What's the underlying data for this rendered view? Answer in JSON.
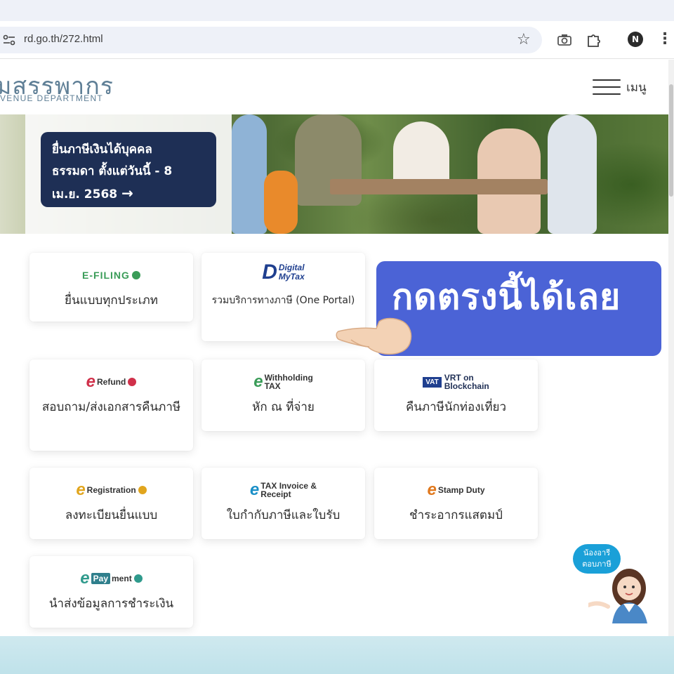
{
  "browser": {
    "url": "rd.go.th/272.html",
    "profile_initial": "N",
    "icons": [
      "site-info-icon",
      "star-icon",
      "camera-icon",
      "extensions-icon",
      "kebab-menu-icon"
    ]
  },
  "header": {
    "logo_main": "มสรรพากร",
    "logo_sub": "VENUE DEPARTMENT",
    "menu_label": "เมนู"
  },
  "hero": {
    "cta_line1": "ยื่นภาษีเงินได้บุคคล",
    "cta_line2": "ธรรมดา ตั้งแต่วันนี้ - 8",
    "cta_line3": "เม.ย. 2568",
    "cta_arrow": "→"
  },
  "services": [
    {
      "logo": "E-FILING",
      "label": "ยื่นแบบทุกประเภท",
      "color": "#3a9c58"
    },
    {
      "logo_line1": "Digital",
      "logo_line2": "MyTax",
      "label": "รวมบริการทางภาษี (One Portal)",
      "color": "#1f3f8f"
    },
    {
      "logo": "Refund",
      "label": "สอบถาม/ส่งเอกสารคืนภาษี",
      "color": "#d0304a"
    },
    {
      "logo_line1": "Withholding",
      "logo_line2": "TAX",
      "label": "หัก ณ ที่จ่าย",
      "color": "#3a9c58"
    },
    {
      "logo_badge": "VAT",
      "logo_line1": "VRT on",
      "logo_line2": "Blockchain",
      "label": "คืนภาษีนักท่องเที่ยว",
      "color": "#1f3f8f"
    },
    {
      "logo": "Registration",
      "label": "ลงทะเบียนยื่นแบบ",
      "color": "#e1a51d"
    },
    {
      "logo_line1": "TAX Invoice &",
      "logo_line2": "Receipt",
      "label": "ใบกำกับภาษีและใบรับ",
      "color": "#1a8fc7"
    },
    {
      "logo": "Stamp Duty",
      "label": "ชำระอากรแสตมป์",
      "color": "#e0781d"
    },
    {
      "logo_box": "Pay",
      "logo": "ment",
      "label": "นำส่งข้อมูลการชำระเงิน",
      "color": "#2f9a8c"
    }
  ],
  "callout": {
    "text": "กดตรงนี้ได้เลย",
    "color": "#4b63d6"
  },
  "chatbot": {
    "line1": "น้องอารี",
    "line2": "ตอบภาษี"
  }
}
